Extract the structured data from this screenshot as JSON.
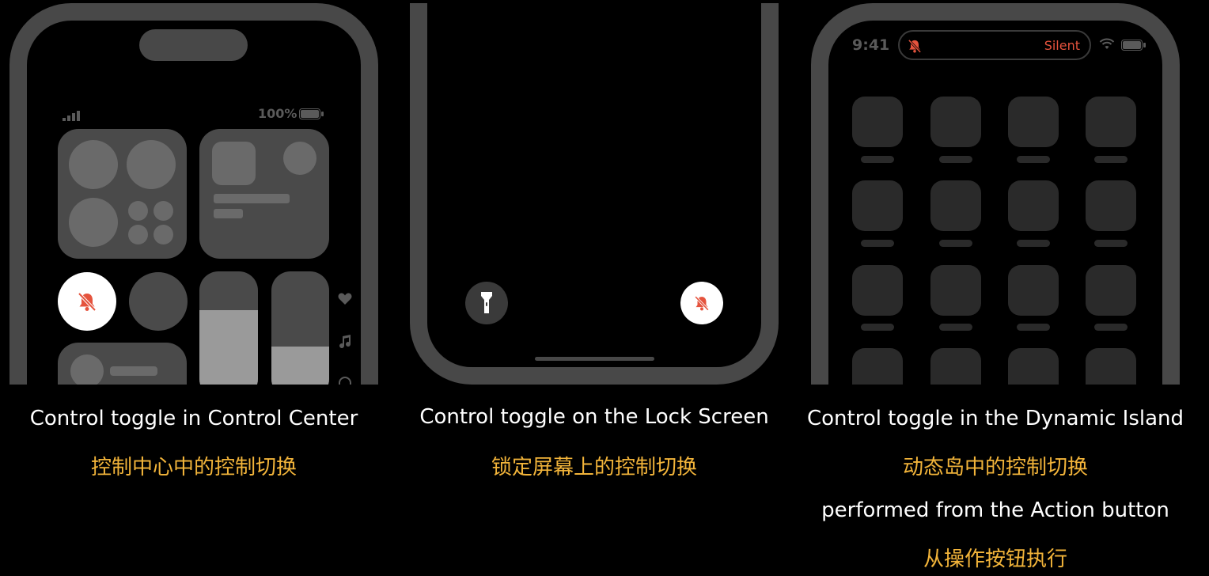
{
  "panels": [
    {
      "id": "control-center",
      "status": {
        "battery_text": "100%"
      },
      "caption_en": "Control toggle in Control Center",
      "caption_zh": "控制中心中的控制切换"
    },
    {
      "id": "lock-screen",
      "caption_en": "Control toggle on the Lock Screen",
      "caption_zh": "锁定屏幕上的控制切换"
    },
    {
      "id": "dynamic-island",
      "status": {
        "time": "9:41",
        "island_label": "Silent"
      },
      "caption_en": "Control toggle in the Dynamic Island",
      "caption_zh": "动态岛中的控制切换",
      "caption_en_2": "performed from the Action button",
      "caption_zh_2": "从操作按钮执行"
    }
  ],
  "colors": {
    "background": "#000000",
    "frame": "#484848",
    "accent_red": "#e5533d",
    "caption_zh": "#f2b43a"
  },
  "icons": [
    "bell-slash-icon",
    "flashlight-icon",
    "heart-icon",
    "music-note-icon",
    "signal-icon",
    "battery-icon",
    "wifi-icon"
  ]
}
